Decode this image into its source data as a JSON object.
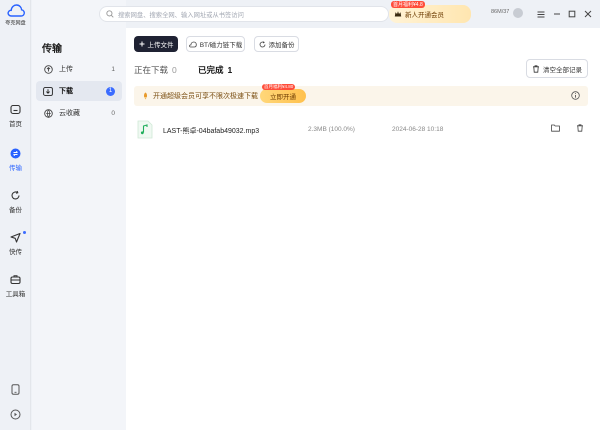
{
  "app": {
    "name": "夸克网盘"
  },
  "rail": {
    "items": [
      {
        "label": "首页"
      },
      {
        "label": "传输"
      },
      {
        "label": "备份"
      },
      {
        "label": "快传"
      },
      {
        "label": "工具箱"
      }
    ]
  },
  "panel": {
    "title": "传输",
    "items": [
      {
        "label": "上传",
        "count": "1"
      },
      {
        "label": "下载",
        "count": "1"
      },
      {
        "label": "云收藏",
        "count": "0"
      }
    ]
  },
  "topbar": {
    "search_placeholder": "搜索网盘、搜索全网、输入网址或从书签访问",
    "vip_promo": "首月福利¥4.8",
    "vip_label": "新人开通会员",
    "storage": "86M/37"
  },
  "toolbar": {
    "upload": "上传文件",
    "bt_download": "BT/磁力链下载",
    "add_backup": "添加备份"
  },
  "tabs": {
    "downloading_label": "正在下载",
    "downloading_count": "0",
    "done_label": "已完成",
    "done_count": "1",
    "clear_all": "清空全部记录"
  },
  "banner": {
    "text": "开通超级会员可享不限次极速下载",
    "cta_tag": "首月福利¥4.80",
    "cta": "立即开通"
  },
  "files": [
    {
      "name": "LAST-熊卓-04bafab49032.mp3",
      "size": "2.3MB (100.0%)",
      "time": "2024-06-28 10:18"
    }
  ],
  "colors": {
    "accent": "#2962ff",
    "primary_button": "#1f2233",
    "banner_bg": "#fbf5ea"
  }
}
